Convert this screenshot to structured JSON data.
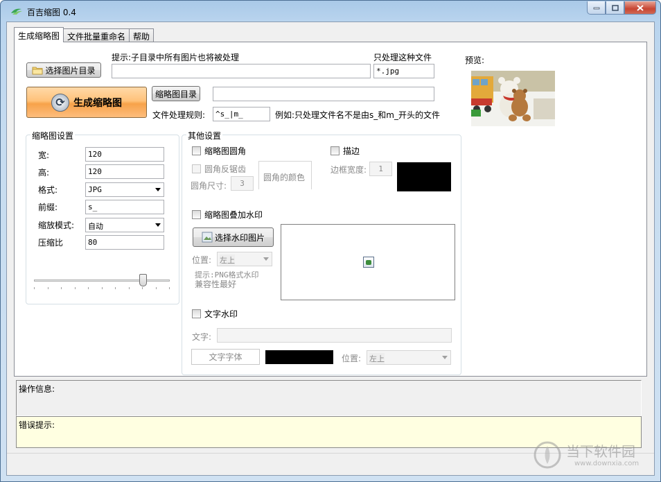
{
  "window": {
    "title": "百吉缩图 0.4"
  },
  "tabs": [
    {
      "label": "生成缩略图",
      "active": true
    },
    {
      "label": "文件批量重命名",
      "active": false
    },
    {
      "label": "帮助",
      "active": false
    }
  ],
  "main": {
    "hint_label": "提示:子目录中所有图片也将被处理",
    "select_dir_button": "选择图片目录",
    "source_dir_value": "",
    "filter_label": "只处理这种文件",
    "filter_value": "*.jpg",
    "generate_button": "生成缩略图",
    "thumb_dir_button": "缩略图目录",
    "thumb_dir_value": "",
    "rule_label": "文件处理规则:",
    "rule_value": "^s_|m_",
    "rule_example": "例如:只处理文件名不是由s_和m_开头的文件",
    "preview_label": "预览:"
  },
  "thumb_settings": {
    "title": "缩略图设置",
    "width_label": "宽:",
    "width_value": "120",
    "height_label": "高:",
    "height_value": "120",
    "format_label": "格式:",
    "format_value": "JPG",
    "prefix_label": "前缀:",
    "prefix_value": "s_",
    "scale_label": "缩放模式:",
    "scale_value": "自动",
    "quality_label": "压缩比",
    "quality_value": "80",
    "quality_slider_fraction": 0.8
  },
  "other_settings": {
    "title": "其他设置",
    "round_corner": "缩略图圆角",
    "antialias": "圆角反锯齿",
    "corner_size_label": "圆角尺寸:",
    "corner_size_value": "3",
    "corner_color_label": "圆角的颜色",
    "border": "描边",
    "border_width_label": "边框宽度:",
    "border_width_value": "1",
    "border_color": "#000000",
    "watermark": "缩略图叠加水印",
    "select_watermark_button": "选择水印图片",
    "position_label": "位置:",
    "position_value": "左上",
    "watermark_hint_1": "提示:PNG格式水印",
    "watermark_hint_2": "兼容性最好",
    "text_watermark": "文字水印",
    "text_label": "文字:",
    "text_value": "",
    "font_button": "文字字体",
    "font_color": "#000000",
    "text_position_label": "位置:",
    "text_position_value": "左上"
  },
  "status": {
    "info_label": "操作信息:",
    "error_label": "错误提示:"
  },
  "site_watermark": {
    "name": "当下软件园",
    "url": "www.downxia.com"
  }
}
